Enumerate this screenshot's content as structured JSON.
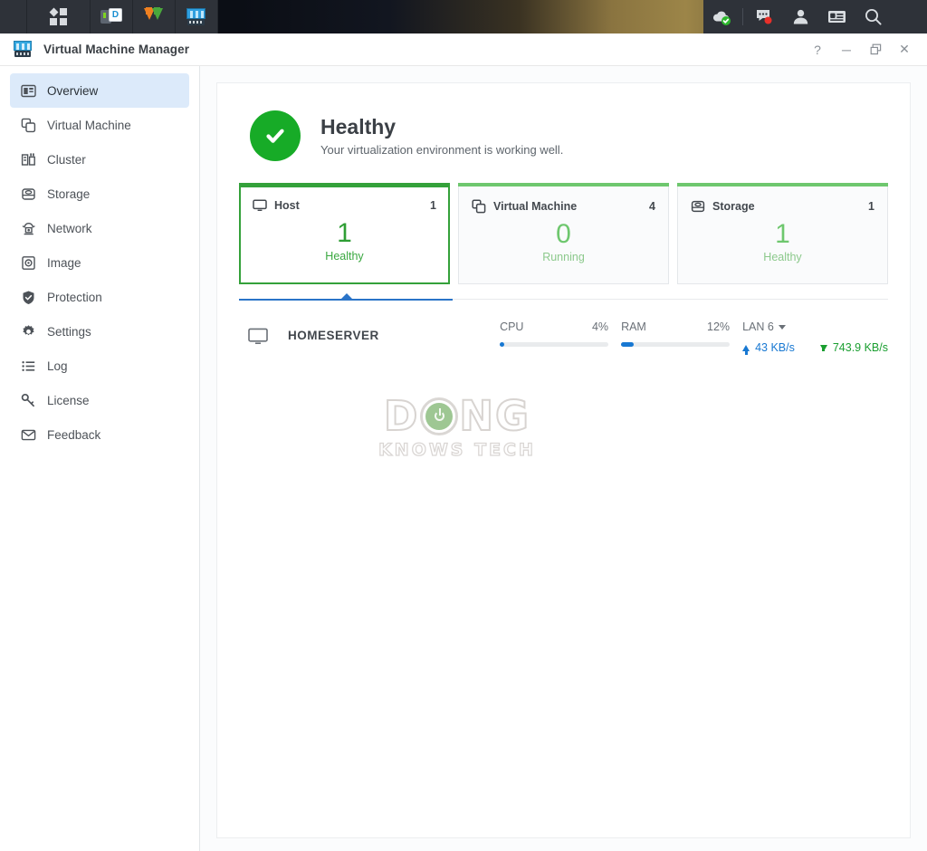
{
  "taskbar": {
    "menu_icon": "app-grid-icon",
    "apps": [
      {
        "name": "drive-sync-app",
        "icon": "drive-dsm-icon"
      },
      {
        "name": "download-station-app",
        "icon": "download-arrows-icon"
      },
      {
        "name": "virtual-machine-manager-app",
        "icon": "vmm-server-icon"
      }
    ],
    "tray": [
      {
        "name": "cloud-sync-status",
        "icon": "cloud-check-icon"
      },
      {
        "name": "notifications",
        "icon": "chat-bubble-icon",
        "badge": true
      },
      {
        "name": "user-account",
        "icon": "person-icon"
      },
      {
        "name": "widgets-panel",
        "icon": "widget-panel-icon"
      },
      {
        "name": "search",
        "icon": "search-icon"
      }
    ]
  },
  "window": {
    "title": "Virtual Machine Manager",
    "app_icon": "vmm-server-icon",
    "controls": {
      "help": "?",
      "minimize": "─",
      "restore": "❐",
      "close": "✕"
    }
  },
  "sidebar": {
    "items": [
      {
        "label": "Overview",
        "icon": "overview-panel-icon",
        "active": true
      },
      {
        "label": "Virtual Machine",
        "icon": "copy-windows-icon",
        "active": false
      },
      {
        "label": "Cluster",
        "icon": "cluster-icon",
        "active": false
      },
      {
        "label": "Storage",
        "icon": "database-icon",
        "active": false
      },
      {
        "label": "Network",
        "icon": "network-node-icon",
        "active": false
      },
      {
        "label": "Image",
        "icon": "image-disc-icon",
        "active": false
      },
      {
        "label": "Protection",
        "icon": "shield-icon",
        "active": false
      },
      {
        "label": "Settings",
        "icon": "gear-icon",
        "active": false
      },
      {
        "label": "Log",
        "icon": "list-icon",
        "active": false
      },
      {
        "label": "License",
        "icon": "key-icon",
        "active": false
      },
      {
        "label": "Feedback",
        "icon": "envelope-icon",
        "active": false
      }
    ]
  },
  "main": {
    "health": {
      "icon": "check-circle-icon",
      "title": "Healthy",
      "subtitle": "Your virtualization environment is working well.",
      "color": "#17ab27"
    },
    "cards": [
      {
        "label": "Host",
        "icon": "monitor-icon",
        "count": "1",
        "value": "1",
        "status": "Healthy",
        "selected": true,
        "accent": "#34a13a"
      },
      {
        "label": "Virtual Machine",
        "icon": "copy-windows-icon",
        "count": "4",
        "value": "0",
        "status": "Running",
        "selected": false,
        "accent": "#6ec76e"
      },
      {
        "label": "Storage",
        "icon": "database-icon",
        "count": "1",
        "value": "1",
        "status": "Healthy",
        "selected": false,
        "accent": "#6ec76e"
      }
    ],
    "host": {
      "icon": "monitor-icon",
      "name": "HOMESERVER",
      "metrics": [
        {
          "label": "CPU",
          "value": "4%",
          "percent": 4
        },
        {
          "label": "RAM",
          "value": "12%",
          "percent": 12
        }
      ],
      "network": {
        "interface": "LAN 6",
        "dropdown_icon": "chevron-down-icon",
        "upload": {
          "icon": "arrow-up-icon",
          "value": "43 KB/s",
          "color": "#1878d2"
        },
        "download": {
          "icon": "arrow-down-icon",
          "value": "743.9 KB/s",
          "color": "#1a9e30"
        }
      }
    },
    "watermark": {
      "line1_left": "D",
      "line1_right": "NG",
      "line2": "KNOWS TECH",
      "logo_icon": "power-button-icon"
    }
  }
}
